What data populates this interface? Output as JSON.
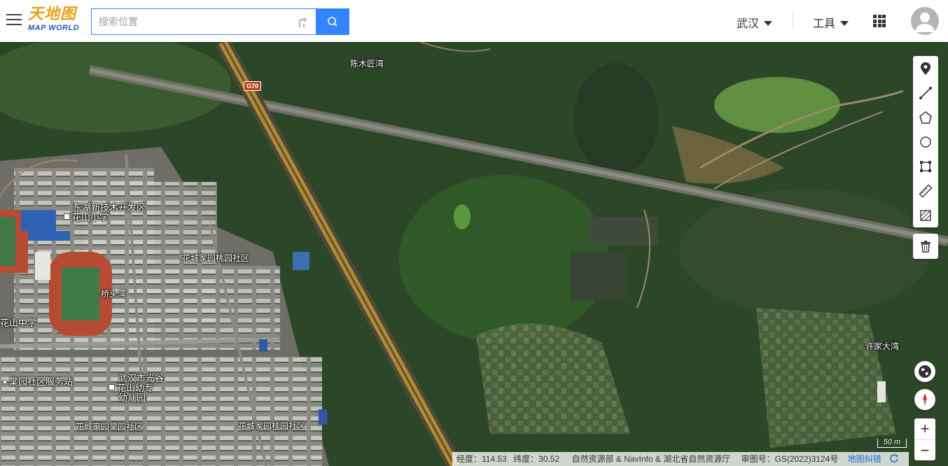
{
  "header": {
    "logo_cn": "天地图",
    "logo_en": "MAP WORLD",
    "search_placeholder": "搜索位置",
    "city": "武汉",
    "tools_label": "工具"
  },
  "map": {
    "road_shield": "G70",
    "labels": {
      "chen_muliang": "陈木匠湾",
      "donghu_hightech": "东湖新技术开发区",
      "huashan_primary": "花山小学",
      "taoyuan": "花城家园桃园社区",
      "qiaotouwan": "桥头湾",
      "huashan_middle": "花山中学",
      "tangyuan_station": "棠园社区服务站",
      "kindergarten_1": "武汉市光谷",
      "kindergarten_2": "花山幼专",
      "kindergarten_3": "幼儿园",
      "tangyuan_community": "花城家园棠园社区",
      "guiyuan_community": "花城家园桂园社区",
      "xujia_dawan": "许家大湾"
    },
    "scale_label": "50 m"
  },
  "toolbox": {
    "items": [
      "marker-tool",
      "polyline-tool",
      "polygon-tool",
      "circle-tool",
      "rectangle-tool",
      "ruler-tool",
      "area-tool"
    ]
  },
  "zoom": {
    "in": "+",
    "out": "−"
  },
  "footer": {
    "longitude": "经度：114.53",
    "latitude": "纬度：30.52",
    "attribution": "自然资源部 & NavInfo & 湖北省自然资源厅",
    "approval": "审图号：GS(2022)3124号",
    "report_link": "地图纠错"
  },
  "colors": {
    "accent": "#3385ff",
    "vegetation": "#2f4a2a",
    "expressway": "#b88a2e"
  }
}
